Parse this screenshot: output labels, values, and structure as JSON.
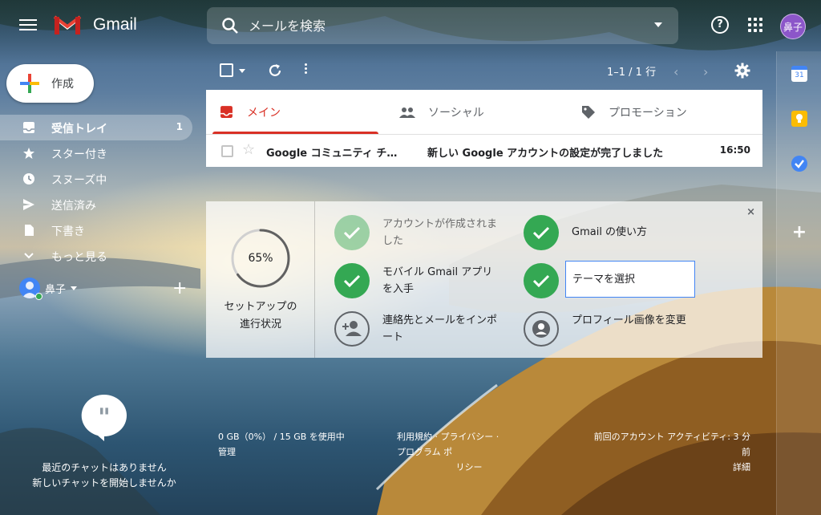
{
  "header": {
    "app_name": "Gmail",
    "search_placeholder": "メールを検索",
    "help_glyph": "?",
    "account_initials": "鼻子"
  },
  "sidebar": {
    "compose_label": "作成",
    "items": [
      {
        "label": "受信トレイ",
        "count": "1",
        "icon": "inbox-icon"
      },
      {
        "label": "スター付き",
        "count": "",
        "icon": "star-icon"
      },
      {
        "label": "スヌーズ中",
        "count": "",
        "icon": "clock-icon"
      },
      {
        "label": "送信済み",
        "count": "",
        "icon": "send-icon"
      },
      {
        "label": "下書き",
        "count": "",
        "icon": "draft-icon"
      },
      {
        "label": "もっと見る",
        "count": "",
        "icon": "chevron-down-icon"
      }
    ],
    "hangouts_user": "鼻子",
    "chat_empty_line1": "最近のチャットはありません",
    "chat_empty_line2": "新しいチャットを開始しませんか"
  },
  "toolbar": {
    "range": "1–1 / 1 行",
    "prev": "‹",
    "next": "›"
  },
  "tabs": [
    {
      "label": "メイン",
      "icon": "inbox-icon",
      "active": true
    },
    {
      "label": "ソーシャル",
      "icon": "people-icon",
      "active": false
    },
    {
      "label": "プロモーション",
      "icon": "tag-icon",
      "active": false
    }
  ],
  "messages": [
    {
      "sender": "Google コミュニティ チ…",
      "subject": "新しい Google アカウントの設定が完了しました",
      "time": "16:50"
    }
  ],
  "setup": {
    "progress_percent": 65,
    "progress_label": "65%",
    "caption_line1": "セットアップの",
    "caption_line2": "進行状況",
    "tasks": [
      {
        "label": "アカウントが作成されました",
        "state": "done-faded"
      },
      {
        "label": "Gmail の使い方",
        "state": "done"
      },
      {
        "label": "モバイル Gmail アプリを入手",
        "state": "done"
      },
      {
        "label": "テーマを選択",
        "state": "done-selected"
      },
      {
        "label": "連絡先とメールをインポート",
        "state": "todo"
      },
      {
        "label": "プロフィール画像を変更",
        "state": "todo"
      }
    ],
    "close": "×"
  },
  "footer": {
    "storage_line1": "0 GB（0%） / 15 GB を使用中",
    "storage_line2": "管理",
    "links_line1": "利用規約 · プライバシー · プログラム ポ",
    "links_line2": "リシー",
    "activity_line1": "前回のアカウント アクティビティ: 3 分",
    "activity_line2": "前",
    "activity_line3": "詳細"
  },
  "side_rail": {
    "calendar_day": "31",
    "add": "+"
  },
  "colors": {
    "accent_red": "#d93025",
    "check_green": "#34a853",
    "avatar_purple": "#8c56c9"
  }
}
